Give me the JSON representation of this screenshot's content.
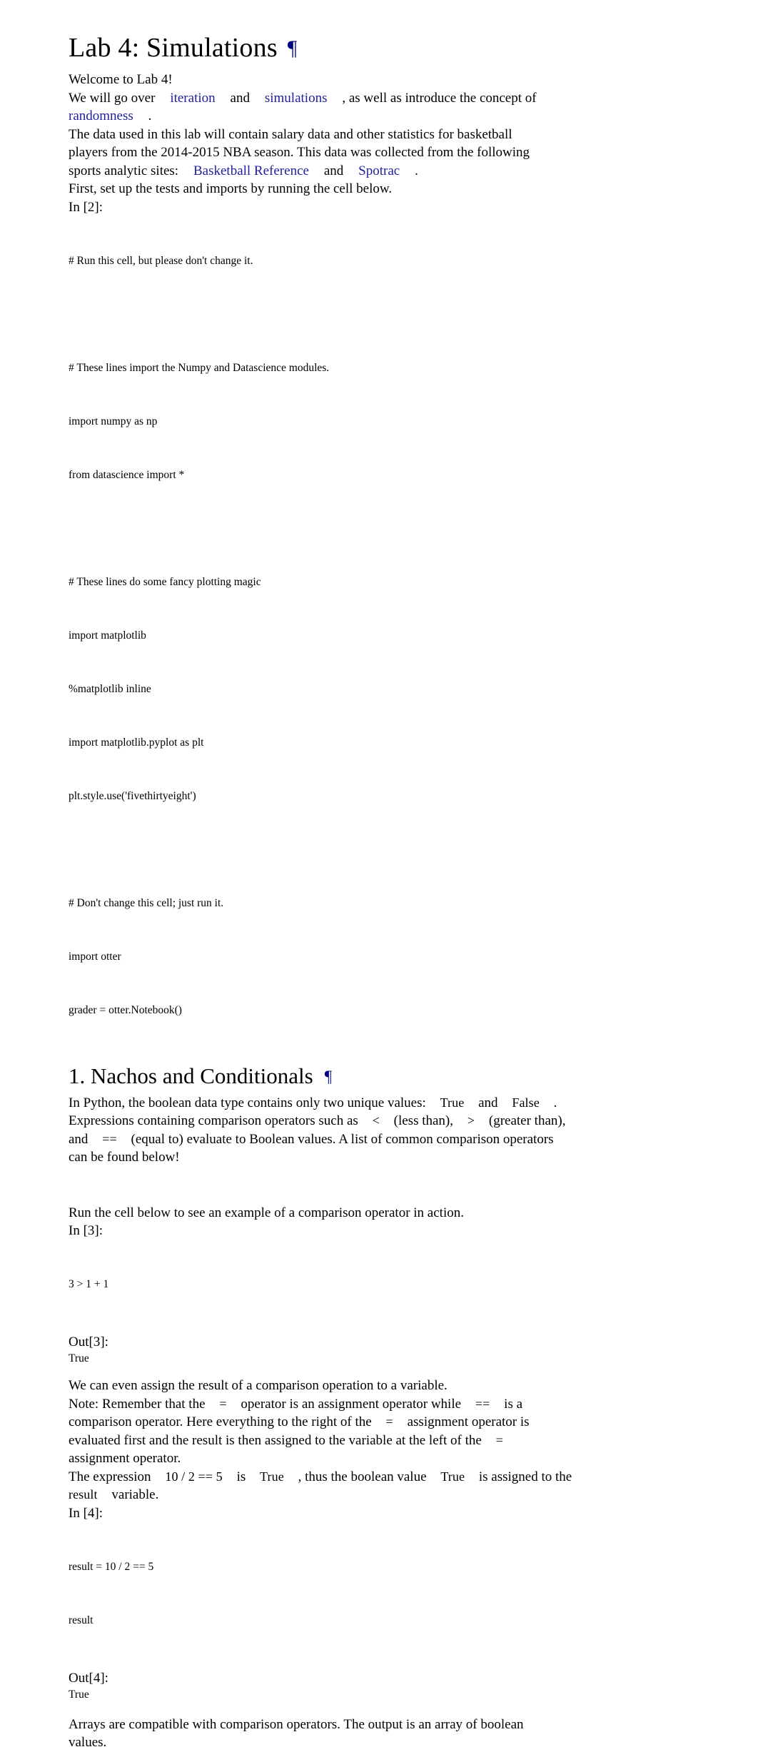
{
  "document": {
    "title": "Lab 4: Simulations",
    "pilcrow": "¶"
  },
  "intro": {
    "welcome": "Welcome to Lab 4!",
    "line2_pre": "We will go over",
    "link_iteration": "iteration",
    "and_1": "and",
    "link_simulations": "simulations",
    "line2_post": ", as well as introduce the concept of",
    "link_randomness": "randomness",
    "period": ".",
    "para_data_1": "The data used in this lab will contain salary data and other statistics for basketball",
    "para_data_2": "players from the 2014-2015 NBA season. This data was collected from the following",
    "para_data_3_pre": "sports analytic sites:",
    "link_basketball_reference": "Basketball Reference",
    "and_2": "and",
    "link_spotrac": "Spotrac",
    "para_data_3_post": ".",
    "para_first": "First, set up the tests and imports by running the cell below."
  },
  "cell_2": {
    "prompt": "In [2]:",
    "lines": [
      "# Run this cell, but please don't change it.",
      "",
      "# These lines import the Numpy and Datascience modules.",
      "import numpy as np",
      "from datascience import *",
      "",
      "# These lines do some fancy plotting magic",
      "import matplotlib",
      "%matplotlib inline",
      "import matplotlib.pyplot as plt",
      "plt.style.use('fivethirtyeight')",
      "",
      "# Don't change this cell; just run it.",
      "import otter",
      "grader = otter.Notebook()"
    ]
  },
  "section_1": {
    "title": "1. Nachos and Conditionals",
    "pilcrow": "¶",
    "p1_a": "In Python, the boolean data type contains only two unique values:",
    "code_true_1": "True",
    "p1_b": "and",
    "code_false": "False",
    "p1_c": ".",
    "p1_d": "Expressions containing comparison operators such as",
    "code_lt": "<",
    "p1_e": "(less than),",
    "code_gt": ">",
    "p1_f": "(greater than),",
    "p1_g": "and",
    "code_eqeq": "==",
    "p1_h": "(equal to) evaluate to Boolean values. A list of common comparison operators",
    "p1_i": "can be found below!",
    "run_cell": "Run the cell below to see an example of a comparison operator in action."
  },
  "cell_3": {
    "prompt": "In [3]:",
    "code": "3 > 1 + 1",
    "out_prompt": "Out[3]:",
    "out_value": "True"
  },
  "assign_text": {
    "p1": "We can even assign the result of a comparison operation to a variable.",
    "p2_a": "Note: Remember that the",
    "code_eq_1": "=",
    "p2_b": "operator is an assignment operator while",
    "code_eqeq_2": "==",
    "p2_c": "is a",
    "p2_d": "comparison operator. Here everything to the right of the",
    "code_eq_2": "=",
    "p2_e": "assignment operator is",
    "p2_f": "evaluated first and the result is then assigned to the variable at the left of the",
    "code_eq_3": "=",
    "p2_g": "assignment operator.",
    "p3_a": "The expression",
    "code_expr": "10 / 2 == 5",
    "p3_b": "is",
    "code_true_2": "True",
    "p3_c": ", thus the boolean value",
    "code_true_3": "True",
    "p3_d": "is assigned to the",
    "code_result": "result",
    "p3_e": "variable."
  },
  "cell_4": {
    "prompt": "In [4]:",
    "code_line_1": "result = 10 / 2 == 5",
    "code_line_2": "result",
    "out_prompt": "Out[4]:",
    "out_value": "True"
  },
  "closing": {
    "p1": "Arrays are compatible with comparison operators. The output is an array of boolean",
    "p2": "values."
  },
  "colors": {
    "link": "#2020a0",
    "pilcrow": "#000080",
    "text": "#000000",
    "background": "#ffffff"
  }
}
